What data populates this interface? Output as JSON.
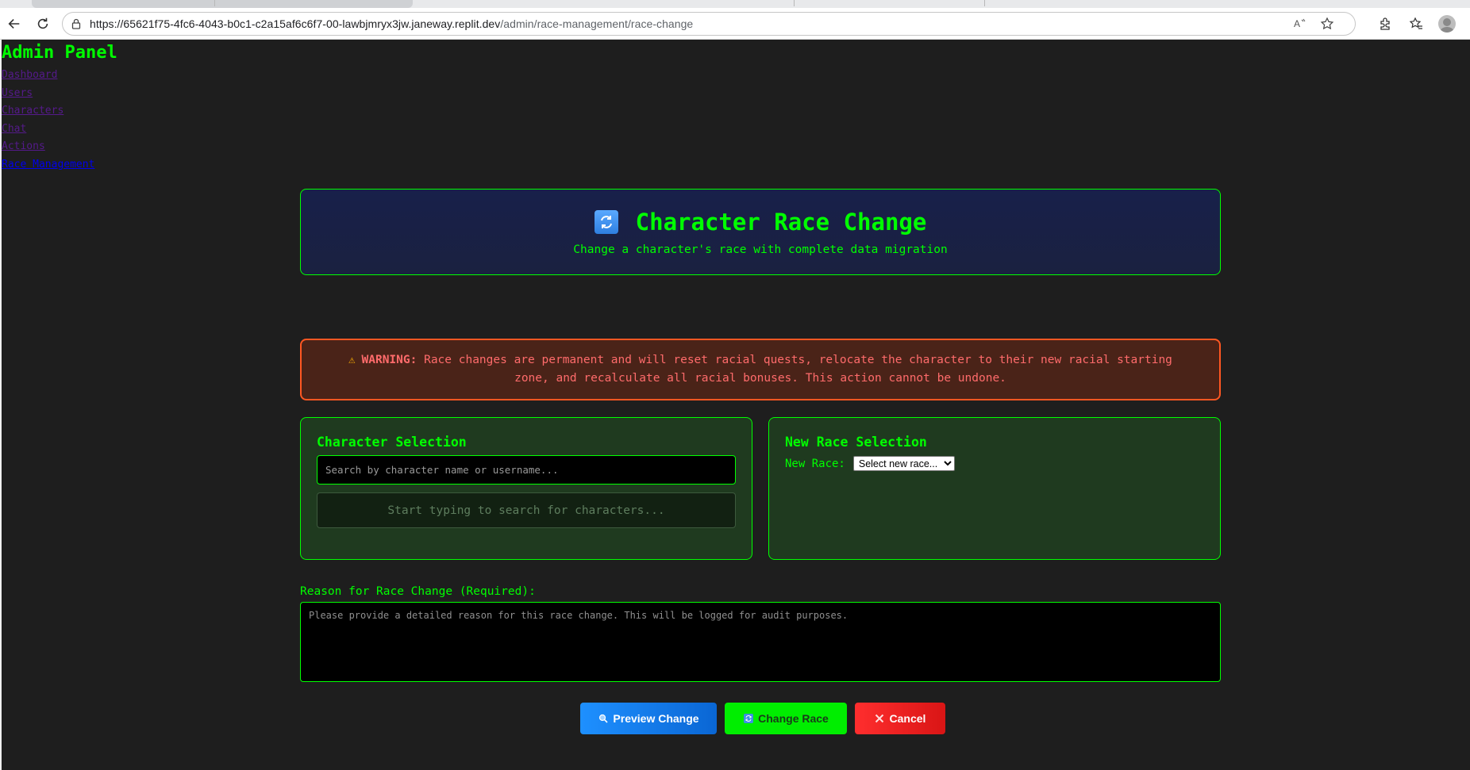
{
  "browser": {
    "url_host": "https://65621f75-4fc6-4043-b0c1-c2a15af6c6f7-00-lawbjmryx3jw.janeway.replit.dev",
    "url_path": "/admin/race-management/race-change",
    "icons": [
      "back-icon",
      "reload-icon",
      "lock-icon",
      "read-aloud-icon",
      "favorite-star-icon",
      "extensions-icon",
      "favorites-icon",
      "profile-avatar"
    ]
  },
  "sidebar": {
    "title": "Admin Panel",
    "links": [
      {
        "label": "Dashboard"
      },
      {
        "label": "Users"
      },
      {
        "label": "Characters"
      },
      {
        "label": "Chat"
      },
      {
        "label": "Actions"
      },
      {
        "label": "Race Management"
      }
    ]
  },
  "header": {
    "title": "Character Race Change",
    "subtitle": "Change a character's race with complete data migration",
    "icon": "swap-arrows-icon"
  },
  "warning": {
    "label": "WARNING:",
    "text": "Race changes are permanent and will reset racial quests, relocate the character to their new racial starting zone, and recalculate all racial bonuses. This action cannot be undone."
  },
  "character_selection": {
    "title": "Character Selection",
    "search_placeholder": "Search by character name or username...",
    "results_hint": "Start typing to search for characters..."
  },
  "race_selection": {
    "title": "New Race Selection",
    "label": "New Race:",
    "selected": "Select new race..."
  },
  "reason": {
    "label": "Reason for Race Change (Required):",
    "placeholder": "Please provide a detailed reason for this race change. This will be logged for audit purposes."
  },
  "buttons": {
    "preview": "Preview Change",
    "change": "Change Race",
    "cancel": "Cancel"
  },
  "colors": {
    "accent": "#00ff00",
    "background": "#1e1e1e",
    "warning_border": "#ff5722",
    "preview_button": "#1e90ff",
    "change_button": "#00ee00",
    "cancel_button": "#ff2e2e"
  }
}
